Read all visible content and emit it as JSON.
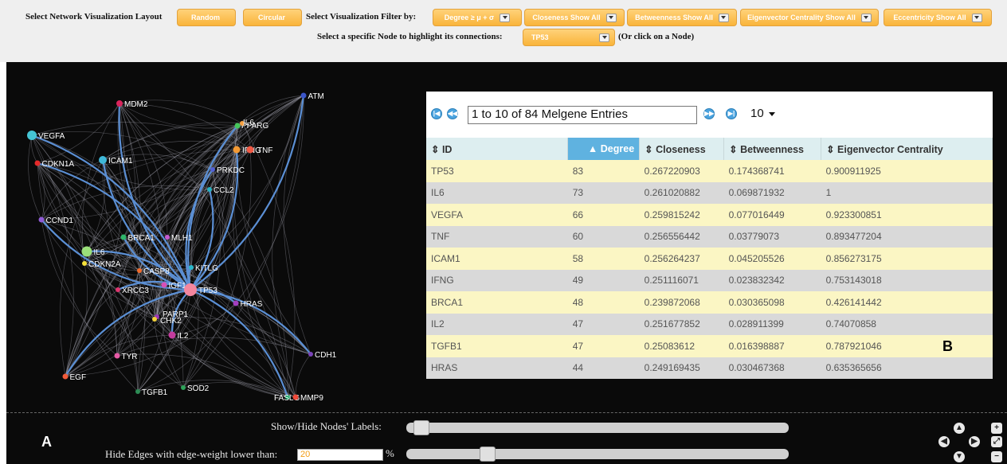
{
  "toolbar": {
    "layout_label": "Select Network Visualization Layout",
    "layout_buttons": [
      "Random",
      "Circular"
    ],
    "filter_label": "Select Visualization Filter by:",
    "filters": [
      "Degree ≥ μ + σ",
      "Closeness Show All",
      "Betweenness Show All",
      "Eigenvector Centrality Show All",
      "Eccentricity Show All"
    ],
    "node_select_label": "Select a specific Node to highlight its connections:",
    "node_select_value": "TP53",
    "node_select_hint": "(Or click on a Node)"
  },
  "graph": {
    "nodes": [
      {
        "id": "MDM2",
        "color": "#d8245c"
      },
      {
        "id": "VEGFA",
        "color": "#45c5d5"
      },
      {
        "id": "ICAM1",
        "color": "#3fb8d8"
      },
      {
        "id": "CDKN1A",
        "color": "#e52a2a"
      },
      {
        "id": "CCND1",
        "color": "#8f5bd6"
      },
      {
        "id": "IL6",
        "color": "#9be07a"
      },
      {
        "id": "CDKN2A",
        "color": "#f5e13a"
      },
      {
        "id": "BRCA1",
        "color": "#2fb56a"
      },
      {
        "id": "MLH1",
        "color": "#c75ad1"
      },
      {
        "id": "CASP8",
        "color": "#f36b2b"
      },
      {
        "id": "KITLG",
        "color": "#2ab7c9"
      },
      {
        "id": "XRCC3",
        "color": "#e0356f"
      },
      {
        "id": "IGF1",
        "color": "#d850b7"
      },
      {
        "id": "TP53",
        "color": "#f4869e"
      },
      {
        "id": "HRAS",
        "color": "#a23fc0"
      },
      {
        "id": "PARP1",
        "color": "#9a38b4"
      },
      {
        "id": "CHK2",
        "color": "#f2d23a"
      },
      {
        "id": "IL2",
        "color": "#c43c9d"
      },
      {
        "id": "TYR",
        "color": "#e75aa6"
      },
      {
        "id": "CDH1",
        "color": "#7a44b8"
      },
      {
        "id": "EGF",
        "color": "#f05a3a"
      },
      {
        "id": "TGFB1",
        "color": "#2d8d55"
      },
      {
        "id": "SOD2",
        "color": "#2fa35a"
      },
      {
        "id": "FASLG",
        "color": "#1aa86a"
      },
      {
        "id": "MMP9",
        "color": "#f04a3a"
      },
      {
        "id": "ATM",
        "color": "#3b55c8"
      },
      {
        "id": "PPARG",
        "color": "#45c55a"
      },
      {
        "id": "IL6b",
        "label": "IL6",
        "color": "#f6a142"
      },
      {
        "id": "IFNG",
        "color": "#f39a34"
      },
      {
        "id": "TNF",
        "color": "#f05a45"
      },
      {
        "id": "PRKDC",
        "color": "#5361d4"
      },
      {
        "id": "CCL2",
        "color": "#27b3c2"
      }
    ]
  },
  "table": {
    "pager_text": "1 to 10 of 84 Melgene Entries",
    "page_size": "10",
    "columns": [
      "ID",
      "Degree",
      "Closeness",
      "Betweenness",
      "Eigenvector Centrality"
    ],
    "sorted_column": "Degree",
    "rows": [
      [
        "TP53",
        "83",
        "0.267220903",
        "0.174368741",
        "0.900911925"
      ],
      [
        "IL6",
        "73",
        "0.261020882",
        "0.069871932",
        "1"
      ],
      [
        "VEGFA",
        "66",
        "0.259815242",
        "0.077016449",
        "0.923300851"
      ],
      [
        "TNF",
        "60",
        "0.256556442",
        "0.03779073",
        "0.893477204"
      ],
      [
        "ICAM1",
        "58",
        "0.256264237",
        "0.045205526",
        "0.856273175"
      ],
      [
        "IFNG",
        "49",
        "0.251116071",
        "0.023832342",
        "0.753143018"
      ],
      [
        "BRCA1",
        "48",
        "0.239872068",
        "0.030365098",
        "0.426141442"
      ],
      [
        "IL2",
        "47",
        "0.251677852",
        "0.028911399",
        "0.74070858"
      ],
      [
        "TGFB1",
        "47",
        "0.25083612",
        "0.016398887",
        "0.787921046"
      ],
      [
        "HRAS",
        "44",
        "0.249169435",
        "0.030467368",
        "0.635365656"
      ]
    ]
  },
  "panel_labels": {
    "a": "A",
    "b": "B"
  },
  "controls": {
    "labels_toggle": "Show/Hide Nodes' Labels:",
    "labels_slider_fraction": 0.02,
    "edge_filter_label": "Hide Edges with edge-weight lower than:",
    "edge_filter_value": "20",
    "edge_filter_unit": "%",
    "edge_slider_fraction": 0.2
  },
  "navigation": {
    "icons": [
      "arrow-up-icon",
      "arrow-left-icon",
      "arrow-right-icon",
      "arrow-down-icon",
      "zoom-in-icon",
      "fit-screen-icon",
      "zoom-out-icon"
    ]
  }
}
